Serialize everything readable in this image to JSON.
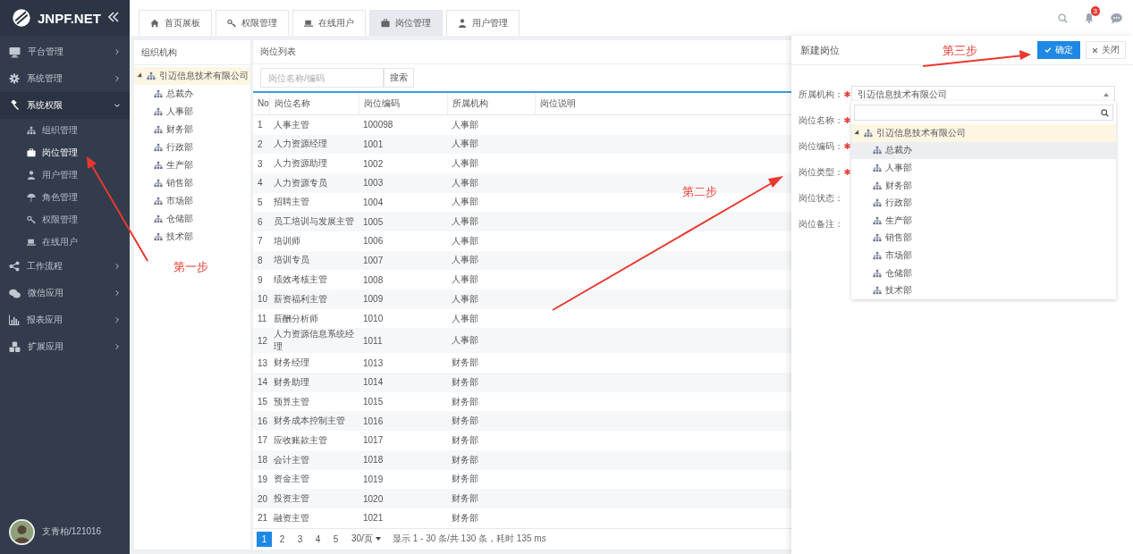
{
  "sidebar": {
    "logo": "JNPF.NET",
    "menu": [
      {
        "label": "平台管理",
        "expanded": false
      },
      {
        "label": "系统管理",
        "expanded": false
      },
      {
        "label": "系统权限",
        "expanded": true,
        "children": [
          {
            "label": "组织管理",
            "selected": false
          },
          {
            "label": "岗位管理",
            "selected": true
          },
          {
            "label": "用户管理",
            "selected": false
          },
          {
            "label": "角色管理",
            "selected": false
          },
          {
            "label": "权限管理",
            "selected": false
          },
          {
            "label": "在线用户",
            "selected": false
          }
        ]
      },
      {
        "label": "工作流程",
        "expanded": false
      },
      {
        "label": "微信应用",
        "expanded": false
      },
      {
        "label": "报表应用",
        "expanded": false
      },
      {
        "label": "扩展应用",
        "expanded": false
      }
    ],
    "user": "支青柏/121016"
  },
  "tabs": [
    {
      "label": "首页展板",
      "selected": false
    },
    {
      "label": "权限管理",
      "selected": false
    },
    {
      "label": "在线用户",
      "selected": false
    },
    {
      "label": "岗位管理",
      "selected": true
    },
    {
      "label": "用户管理",
      "selected": false
    }
  ],
  "header": {
    "notification_count": "3"
  },
  "org_panel": {
    "title": "组织机构",
    "tree": [
      {
        "label": "引迈信息技术有限公司",
        "selected": true,
        "expanded": true,
        "children": [
          {
            "label": "总裁办",
            "selected": false
          },
          {
            "label": "人事部",
            "selected": false
          },
          {
            "label": "财务部",
            "selected": false
          },
          {
            "label": "行政部",
            "selected": false
          },
          {
            "label": "生产部",
            "selected": false
          },
          {
            "label": "销售部",
            "selected": false
          },
          {
            "label": "市场部",
            "selected": false
          },
          {
            "label": "仓储部",
            "selected": false
          },
          {
            "label": "技术部",
            "selected": false
          }
        ]
      }
    ]
  },
  "list_panel": {
    "title": "岗位列表",
    "search": {
      "placeholder": "岗位名称/编码"
    },
    "search_button": "搜索",
    "table": {
      "columns": [
        "No",
        "岗位名称",
        "岗位编码",
        "所属机构",
        "岗位说明"
      ],
      "rows": [
        [
          "1",
          "人事主管",
          "100098",
          "人事部"
        ],
        [
          "2",
          "人力资源经理",
          "1001",
          "人事部"
        ],
        [
          "3",
          "人力资源助理",
          "1002",
          "人事部"
        ],
        [
          "4",
          "人力资源专员",
          "1003",
          "人事部"
        ],
        [
          "5",
          "招聘主管",
          "1004",
          "人事部"
        ],
        [
          "6",
          "员工培训与发展主管",
          "1005",
          "人事部"
        ],
        [
          "7",
          "培训师",
          "1006",
          "人事部"
        ],
        [
          "8",
          "培训专员",
          "1007",
          "人事部"
        ],
        [
          "9",
          "绩效考核主管",
          "1008",
          "人事部"
        ],
        [
          "10",
          "薪资福利主管",
          "1009",
          "人事部"
        ],
        [
          "11",
          "薪酬分析师",
          "1010",
          "人事部"
        ],
        [
          "12",
          "人力资源信息系统经理",
          "1011",
          "人事部"
        ],
        [
          "13",
          "财务经理",
          "1013",
          "财务部"
        ],
        [
          "14",
          "财务助理",
          "1014",
          "财务部"
        ],
        [
          "15",
          "预算主管",
          "1015",
          "财务部"
        ],
        [
          "16",
          "财务成本控制主管",
          "1016",
          "财务部"
        ],
        [
          "17",
          "应收账款主管",
          "1017",
          "财务部"
        ],
        [
          "18",
          "会计主管",
          "1018",
          "财务部"
        ],
        [
          "19",
          "资金主管",
          "1019",
          "财务部"
        ],
        [
          "20",
          "投资主管",
          "1020",
          "财务部"
        ],
        [
          "21",
          "融资主管",
          "1021",
          "财务部"
        ]
      ]
    },
    "pagination": {
      "pages": [
        {
          "label": "1",
          "selected": true
        },
        {
          "label": "2",
          "selected": false
        },
        {
          "label": "3",
          "selected": false
        },
        {
          "label": "4",
          "selected": false
        },
        {
          "label": "5",
          "selected": false
        }
      ],
      "page_size": "30/页",
      "summary": "显示 1 - 30 条/共 130 条，耗时 135 ms"
    }
  },
  "drawer": {
    "title": "新建岗位",
    "confirm_button": "确定",
    "close_button": "关闭",
    "fields": [
      {
        "label": "所属机构：",
        "required": true,
        "value": "引迈信息技术有限公司"
      },
      {
        "label": "岗位名称：",
        "required": true
      },
      {
        "label": "岗位编码：",
        "required": true
      },
      {
        "label": "岗位类型：",
        "required": true
      },
      {
        "label": "岗位状态：",
        "required": false
      },
      {
        "label": "岗位备注：",
        "required": false
      }
    ],
    "dropdown": {
      "tree": [
        {
          "label": "引迈信息技术有限公司",
          "selected": true,
          "expanded": true,
          "children": [
            {
              "label": "总裁办",
              "hovered": true
            },
            {
              "label": "人事部",
              "hovered": false
            },
            {
              "label": "财务部",
              "hovered": false
            },
            {
              "label": "行政部",
              "hovered": false
            },
            {
              "label": "生产部",
              "hovered": false
            },
            {
              "label": "销售部",
              "hovered": false
            },
            {
              "label": "市场部",
              "hovered": false
            },
            {
              "label": "仓储部",
              "hovered": false
            },
            {
              "label": "技术部",
              "hovered": false
            }
          ]
        }
      ]
    }
  },
  "annotations": [
    {
      "text": "第一步"
    },
    {
      "text": "第二步"
    },
    {
      "text": "第三步"
    }
  ]
}
